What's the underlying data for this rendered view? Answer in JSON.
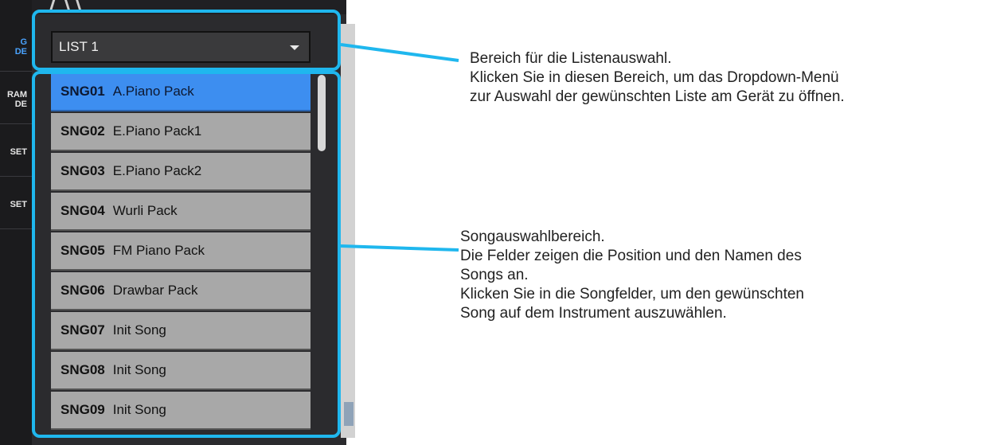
{
  "sidebar": {
    "items": [
      {
        "label": "G\nDE",
        "active": true
      },
      {
        "label": "RAM\nDE",
        "active": false
      },
      {
        "label": "SET",
        "active": false
      },
      {
        "label": "SET",
        "active": false
      }
    ]
  },
  "panel": {
    "logo_glyph": "/\\\\",
    "list_select": {
      "value": "LIST 1"
    },
    "songs": [
      {
        "num": "SNG01",
        "name": "A.Piano Pack",
        "selected": true
      },
      {
        "num": "SNG02",
        "name": "E.Piano Pack1",
        "selected": false
      },
      {
        "num": "SNG03",
        "name": "E.Piano Pack2",
        "selected": false
      },
      {
        "num": "SNG04",
        "name": "Wurli Pack",
        "selected": false
      },
      {
        "num": "SNG05",
        "name": "FM Piano Pack",
        "selected": false
      },
      {
        "num": "SNG06",
        "name": "Drawbar Pack",
        "selected": false
      },
      {
        "num": "SNG07",
        "name": "Init Song",
        "selected": false
      },
      {
        "num": "SNG08",
        "name": "Init Song",
        "selected": false
      },
      {
        "num": "SNG09",
        "name": "Init Song",
        "selected": false
      }
    ]
  },
  "annotations": {
    "select_area": [
      "Bereich für die Listenauswahl.",
      "Klicken Sie in diesen Bereich, um das Dropdown-Menü",
      "zur Auswahl der gewünschten Liste am Gerät zu öffnen."
    ],
    "song_area": [
      "Songauswahlbereich.",
      "Die Felder zeigen die Position und den Namen des",
      "Songs an.",
      "Klicken Sie in die Songfelder, um den gewünschten",
      "Song auf dem Instrument auszuwählen."
    ]
  },
  "colors": {
    "callout": "#1fb7ee",
    "selected_row": "#3d8ef0",
    "row": "#a8a8a8"
  }
}
